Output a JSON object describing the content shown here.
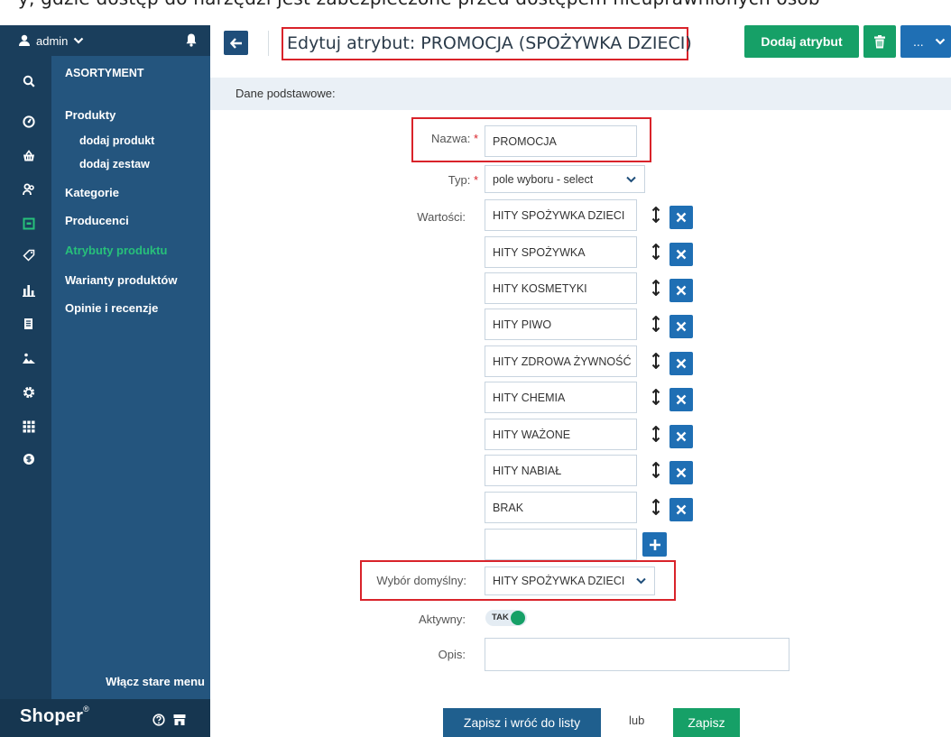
{
  "top_strip_text": "y, gdzie dostęp do narzędzi jest zabezpieczone przed dostępem nieuprawnionych osób",
  "user": {
    "name": "admin"
  },
  "icons": {
    "user": "user-icon",
    "bell": "bell-icon",
    "search": "search-icon",
    "dashboard": "dashboard-icon",
    "orders": "basket-icon",
    "customers": "customers-icon",
    "assortment": "box-icon",
    "promotions": "tag-icon",
    "stats": "bar-chart-icon",
    "content": "pages-icon",
    "appearance": "image-icon",
    "settings": "gear-icon",
    "apps": "grid-icon",
    "billing": "dollar-icon"
  },
  "nav": {
    "section": "ASORTYMENT",
    "items": {
      "produkty": "Produkty",
      "dodaj_produkt": "dodaj produkt",
      "dodaj_zestaw": "dodaj zestaw",
      "kategorie": "Kategorie",
      "producenci": "Producenci",
      "atrybuty": "Atrybuty produktu",
      "warianty": "Warianty produktów",
      "opinie": "Opinie i recenzje"
    },
    "old_menu": "Włącz stare menu"
  },
  "footer": {
    "logo": "Shoper",
    "logo_mark": "®"
  },
  "header": {
    "title": "Edytuj atrybut: PROMOCJA (SPOŻYWKA DZIECI)",
    "add_button": "Dodaj atrybut",
    "more_button": "..."
  },
  "section_label": "Dane podstawowe:",
  "form": {
    "name_label": "Nazwa:",
    "name_value": "PROMOCJA",
    "type_label": "Typ:",
    "type_value": "pole wyboru - select",
    "values_label": "Wartości:",
    "values": [
      "HITY SPOŻYWKA DZIECI",
      "HITY SPOŻYWKA",
      "HITY KOSMETYKI",
      "HITY PIWO",
      "HITY ZDROWA ŻYWNOŚĆ",
      "HITY CHEMIA",
      "HITY WAŻONE",
      "HITY NABIAŁ",
      "BRAK"
    ],
    "new_value": "",
    "default_label": "Wybór domyślny:",
    "default_value": "HITY SPOŻYWKA DZIECI",
    "active_label": "Aktywny:",
    "active_value": "TAK",
    "desc_label": "Opis:",
    "desc_value": "",
    "required_mark": "*"
  },
  "actions": {
    "save_return": "Zapisz i wróć do listy",
    "or": "lub",
    "save": "Zapisz"
  },
  "colors": {
    "sidebar_dark": "#1a3e5c",
    "sidebar": "#24557e",
    "green": "#16a067",
    "blue": "#1f6fb4",
    "red_highlight": "#d9232a"
  }
}
